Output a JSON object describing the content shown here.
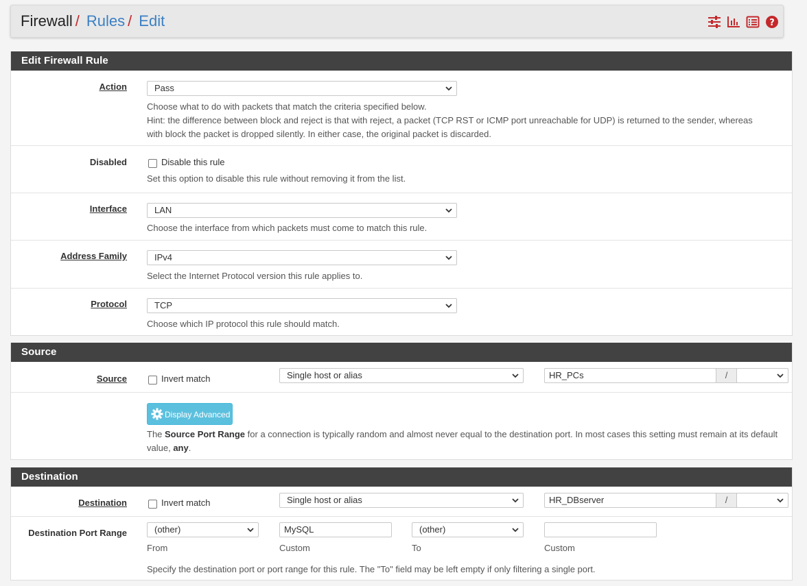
{
  "breadcrumb": {
    "root": "Firewall",
    "sep": "/",
    "rules": "Rules",
    "edit": "Edit"
  },
  "header_icons": [
    "sliders-icon",
    "bar-chart-icon",
    "list-icon",
    "help-icon"
  ],
  "accent": "#c4282b",
  "edit_panel": {
    "title": "Edit Firewall Rule",
    "action": {
      "label": "Action",
      "value": "Pass",
      "help1": "Choose what to do with packets that match the criteria specified below.",
      "help2": "Hint: the difference between block and reject is that with reject, a packet (TCP RST or ICMP port unreachable for UDP) is returned to the sender, whereas with block the packet is dropped silently. In either case, the original packet is discarded."
    },
    "disabled": {
      "label": "Disabled",
      "checkbox_label": "Disable this rule",
      "checked": false,
      "help": "Set this option to disable this rule without removing it from the list."
    },
    "interface": {
      "label": "Interface",
      "value": "LAN",
      "help": "Choose the interface from which packets must come to match this rule."
    },
    "address_family": {
      "label": "Address Family",
      "value": "IPv4",
      "help": "Select the Internet Protocol version this rule applies to."
    },
    "protocol": {
      "label": "Protocol",
      "value": "TCP",
      "help": "Choose which IP protocol this rule should match."
    }
  },
  "source_panel": {
    "title": "Source",
    "source": {
      "label": "Source",
      "invert_label": "Invert match",
      "invert_checked": false,
      "type": "Single host or alias",
      "address": "HR_PCs",
      "slash": "/",
      "mask": ""
    },
    "advanced_button": "Display Advanced",
    "help_pre": "The ",
    "help_bold1": "Source Port Range",
    "help_mid": " for a connection is typically random and almost never equal to the destination port. In most cases this setting must remain at its default value, ",
    "help_bold2": "any",
    "help_post": "."
  },
  "destination_panel": {
    "title": "Destination",
    "destination": {
      "label": "Destination",
      "invert_label": "Invert match",
      "invert_checked": false,
      "type": "Single host or alias",
      "address": "HR_DBserver",
      "slash": "/",
      "mask": ""
    },
    "port_range": {
      "label": "Destination Port Range",
      "from_select": "(other)",
      "from_custom": "MySQL",
      "to_select": "(other)",
      "to_custom": "",
      "from_label": "From",
      "custom_label": "Custom",
      "to_label": "To",
      "custom_label2": "Custom",
      "help": "Specify the destination port or port range for this rule. The \"To\" field may be left empty if only filtering a single port."
    }
  }
}
